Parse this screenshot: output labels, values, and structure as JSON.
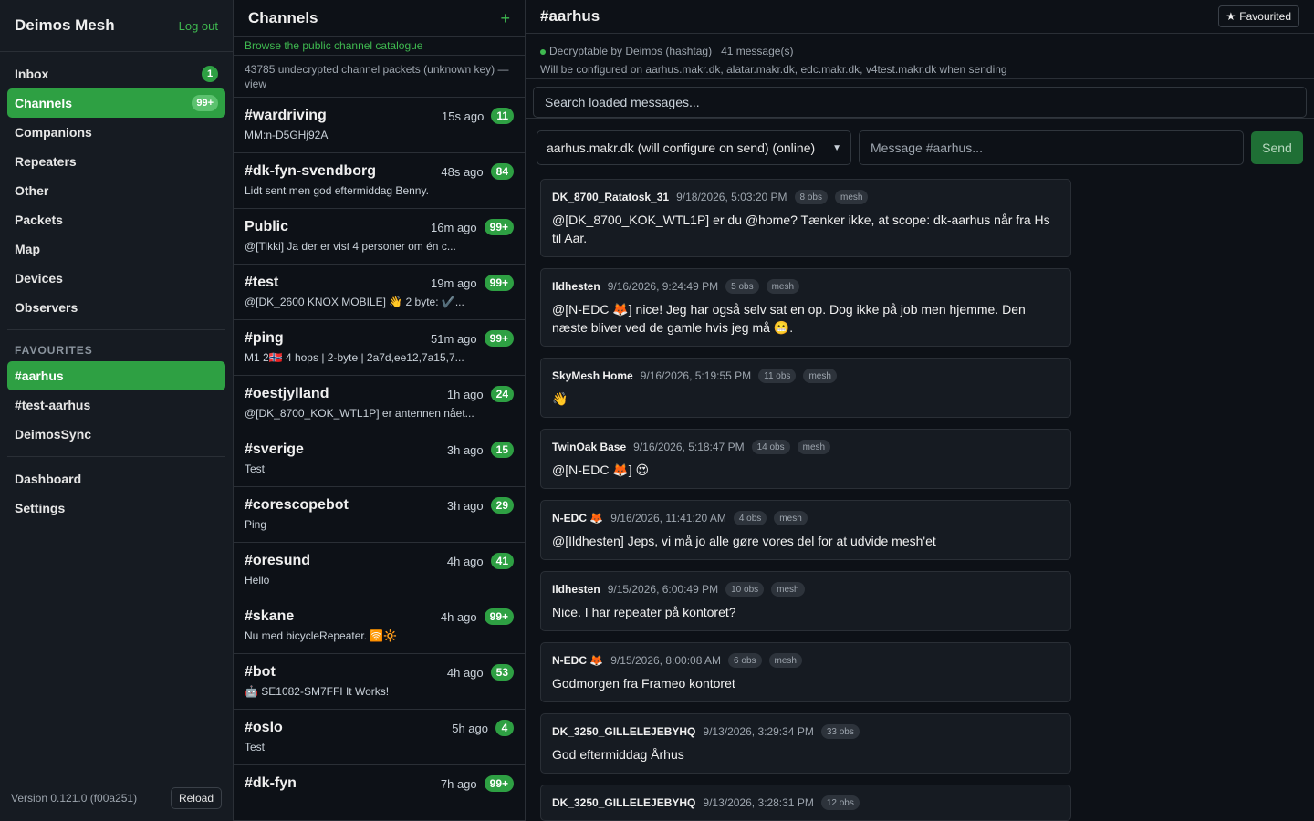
{
  "sidebar": {
    "title": "Deimos Mesh",
    "logout_label": "Log out",
    "nav": [
      {
        "label": "Inbox",
        "badge": "1"
      },
      {
        "label": "Channels",
        "badge": "99+",
        "active": true
      },
      {
        "label": "Companions"
      },
      {
        "label": "Repeaters"
      },
      {
        "label": "Other"
      },
      {
        "label": "Packets"
      },
      {
        "label": "Map"
      },
      {
        "label": "Devices"
      },
      {
        "label": "Observers"
      }
    ],
    "favourites_title": "FAVOURITES",
    "favourites": [
      {
        "label": "#aarhus",
        "active": true
      },
      {
        "label": "#test-aarhus"
      },
      {
        "label": "DeimosSync"
      }
    ],
    "bottom_nav": [
      {
        "label": "Dashboard"
      },
      {
        "label": "Settings"
      }
    ],
    "version": "Version 0.121.0 (f00a251)",
    "reload_label": "Reload"
  },
  "channels": {
    "title": "Channels",
    "add_icon": "plus-icon",
    "browse_label": "Browse the public channel catalogue",
    "undecrypted_label": "43785 undecrypted channel packets (unknown key) — view",
    "items": [
      {
        "name": "#wardriving",
        "time": "15s ago",
        "badge": "11",
        "preview": "MM:n-D5GHj92A"
      },
      {
        "name": "#dk-fyn-svendborg",
        "time": "48s ago",
        "badge": "84",
        "preview": "Lidt sent men god eftermiddag Benny."
      },
      {
        "name": "Public",
        "time": "16m ago",
        "badge": "99+",
        "preview": "@[Tikki] Ja der er vist 4 personer om én c..."
      },
      {
        "name": "#test",
        "time": "19m ago",
        "badge": "99+",
        "preview": "@[DK_2600 KNOX MOBILE] 👋 2 byte: ✔️..."
      },
      {
        "name": "#ping",
        "time": "51m ago",
        "badge": "99+",
        "preview": "M1 2🇳🇴 4 hops | 2-byte | 2a7d,ee12,7a15,7..."
      },
      {
        "name": "#oestjylland",
        "time": "1h ago",
        "badge": "24",
        "preview": "@[DK_8700_KOK_WTL1P] er antennen nået..."
      },
      {
        "name": "#sverige",
        "time": "3h ago",
        "badge": "15",
        "preview": "Test"
      },
      {
        "name": "#corescopebot",
        "time": "3h ago",
        "badge": "29",
        "preview": "Ping"
      },
      {
        "name": "#oresund",
        "time": "4h ago",
        "badge": "41",
        "preview": "Hello"
      },
      {
        "name": "#skane",
        "time": "4h ago",
        "badge": "99+",
        "preview": "Nu med bicycleRepeater. 🛜🔆"
      },
      {
        "name": "#bot",
        "time": "4h ago",
        "badge": "53",
        "preview": "🤖 SE1082-SM7FFI It Works!"
      },
      {
        "name": "#oslo",
        "time": "5h ago",
        "badge": "4",
        "preview": "Test"
      },
      {
        "name": "#dk-fyn",
        "time": "7h ago",
        "badge": "99+",
        "preview": ""
      }
    ]
  },
  "main": {
    "title": "#aarhus",
    "favourite_label": "Favourited",
    "favourite_icon": "star-icon",
    "status": "Decryptable by Deimos (hashtag)",
    "message_count": "41 message(s)",
    "config_note": "Will be configured on aarhus.makr.dk, alatar.makr.dk, edc.makr.dk, v4test.makr.dk when sending",
    "search_placeholder": "Search loaded messages...",
    "route_selected": "aarhus.makr.dk (will configure on send) (online)",
    "message_placeholder": "Message #aarhus...",
    "send_label": "Send",
    "messages": [
      {
        "sender": "DK_8700_Ratatosk_31",
        "time": "9/18/2026, 5:03:20 PM",
        "obs": "8 obs",
        "tag": "mesh",
        "text": "@[DK_8700_KOK_WTL1P] er du @home? Tænker ikke, at scope: dk-aarhus når fra Hs til Aar."
      },
      {
        "sender": "Ildhesten",
        "time": "9/16/2026, 9:24:49 PM",
        "obs": "5 obs",
        "tag": "mesh",
        "text": "@[N-EDC 🦊] nice! Jeg har også selv sat en op. Dog ikke på job men hjemme. Den næste bliver ved de gamle hvis jeg må 😬."
      },
      {
        "sender": "SkyMesh Home",
        "time": "9/16/2026, 5:19:55 PM",
        "obs": "11 obs",
        "tag": "mesh",
        "text": "👋"
      },
      {
        "sender": "TwinOak Base",
        "time": "9/16/2026, 5:18:47 PM",
        "obs": "14 obs",
        "tag": "mesh",
        "text": "@[N-EDC 🦊] 😍"
      },
      {
        "sender": "N-EDC 🦊",
        "time": "9/16/2026, 11:41:20 AM",
        "obs": "4 obs",
        "tag": "mesh",
        "text": "@[Ildhesten] Jeps, vi må jo alle gøre vores del for at udvide mesh'et"
      },
      {
        "sender": "Ildhesten",
        "time": "9/15/2026, 6:00:49 PM",
        "obs": "10 obs",
        "tag": "mesh",
        "text": "Nice. I har repeater på kontoret?"
      },
      {
        "sender": "N-EDC 🦊",
        "time": "9/15/2026, 8:00:08 AM",
        "obs": "6 obs",
        "tag": "mesh",
        "text": "Godmorgen fra Frameo kontoret"
      },
      {
        "sender": "DK_3250_GILLELEJEBYHQ",
        "time": "9/13/2026, 3:29:34 PM",
        "obs": "33 obs",
        "tag": "",
        "text": "God eftermiddag Århus"
      },
      {
        "sender": "DK_3250_GILLELEJEBYHQ",
        "time": "9/13/2026, 3:28:31 PM",
        "obs": "12 obs",
        "tag": "",
        "text": ""
      }
    ]
  },
  "colors": {
    "accent": "#2ea043",
    "background": "#0d1117",
    "panel": "#161b22"
  }
}
